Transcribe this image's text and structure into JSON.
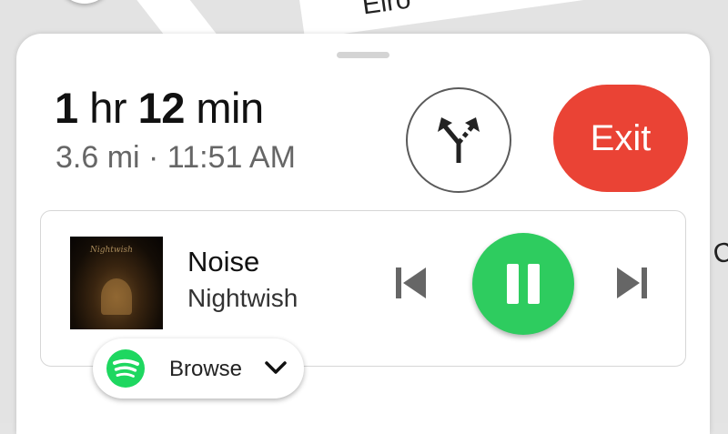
{
  "map": {
    "street_label": "Elro",
    "street_label_right": "C"
  },
  "navigation": {
    "eta_hours_value": "1",
    "eta_hours_unit": "hr",
    "eta_minutes_value": "12",
    "eta_minutes_unit": "min",
    "trip_info": "3.6 mi · 11:51 AM",
    "alt_routes_icon": "route-fork-icon",
    "exit_label": "Exit",
    "exit_color": "#ea4335"
  },
  "media": {
    "album_art_text": "Nightwish",
    "track_title": "Noise",
    "track_artist": "Nightwish",
    "prev_icon": "skip-previous-icon",
    "pause_icon": "pause-icon",
    "next_icon": "skip-next-icon",
    "play_color": "#2ecc5f"
  },
  "browse_chip": {
    "icon": "spotify-icon",
    "label": "Browse",
    "chevron_icon": "chevron-down-icon",
    "spotify_color": "#1ed760"
  }
}
